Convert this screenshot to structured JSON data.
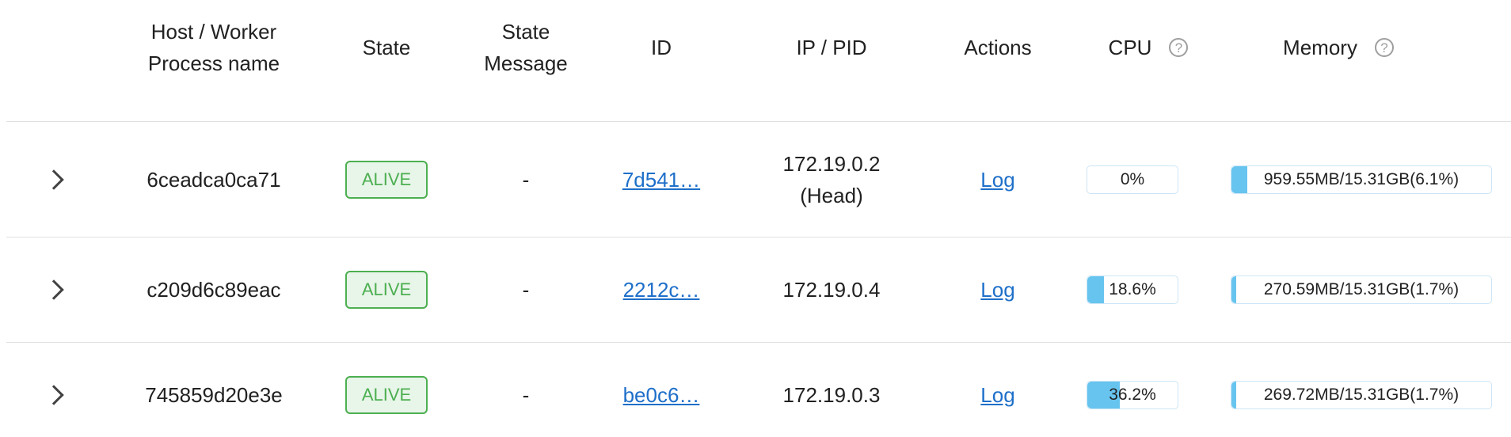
{
  "headers": {
    "host": "Host / Worker Process name",
    "state": "State",
    "state_message": "State Message",
    "id": "ID",
    "ip_pid": "IP / PID",
    "actions": "Actions",
    "cpu": "CPU",
    "memory": "Memory",
    "help_glyph": "?"
  },
  "colors": {
    "alive_border": "#4caf50",
    "alive_bg": "#e8f5e9",
    "link": "#1e6fc9",
    "bar_fill": "#67c4ef"
  },
  "rows": [
    {
      "host": "6ceadca0ca71",
      "state": "ALIVE",
      "state_message": "-",
      "id": "7d541…",
      "ip": "172.19.0.2",
      "pid_note": "(Head)",
      "action": "Log",
      "cpu_label": "0%",
      "cpu_fraction": 0.0,
      "memory_label": "959.55MB/15.31GB(6.1%)",
      "memory_fraction": 0.061
    },
    {
      "host": "c209d6c89eac",
      "state": "ALIVE",
      "state_message": "-",
      "id": "2212c…",
      "ip": "172.19.0.4",
      "pid_note": "",
      "action": "Log",
      "cpu_label": "18.6%",
      "cpu_fraction": 0.186,
      "memory_label": "270.59MB/15.31GB(1.7%)",
      "memory_fraction": 0.017
    },
    {
      "host": "745859d20e3e",
      "state": "ALIVE",
      "state_message": "-",
      "id": "be0c6…",
      "ip": "172.19.0.3",
      "pid_note": "",
      "action": "Log",
      "cpu_label": "36.2%",
      "cpu_fraction": 0.362,
      "memory_label": "269.72MB/15.31GB(1.7%)",
      "memory_fraction": 0.017
    }
  ]
}
